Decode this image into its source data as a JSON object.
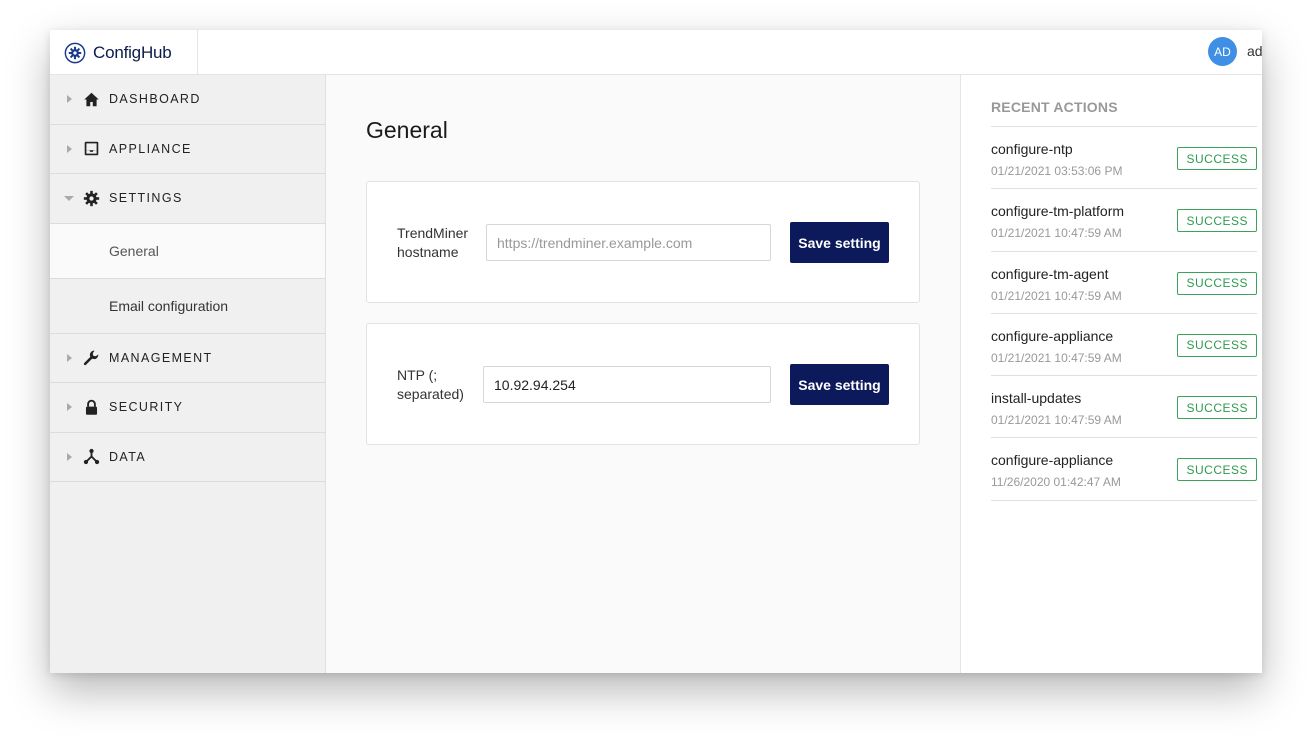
{
  "brand": {
    "name": "ConfigHub"
  },
  "user": {
    "initials": "AD",
    "name": "ad"
  },
  "sidebar": {
    "items": [
      {
        "label": "DASHBOARD",
        "icon": "home-icon"
      },
      {
        "label": "APPLIANCE",
        "icon": "inbox-icon"
      },
      {
        "label": "SETTINGS",
        "icon": "gear-icon",
        "expanded": true,
        "subitems": [
          {
            "label": "General",
            "active": true
          },
          {
            "label": "Email configuration",
            "active": false
          }
        ]
      },
      {
        "label": "MANAGEMENT",
        "icon": "wrench-icon"
      },
      {
        "label": "SECURITY",
        "icon": "lock-icon"
      },
      {
        "label": "DATA",
        "icon": "network-icon"
      }
    ]
  },
  "main": {
    "title": "General",
    "settings": [
      {
        "label_line1": "TrendMiner",
        "label_line2": "hostname",
        "value": "",
        "placeholder": "https://trendminer.example.com",
        "button": "Save setting"
      },
      {
        "label_line1": "NTP (;",
        "label_line2": "separated)",
        "value": "10.92.94.254",
        "placeholder": "",
        "button": "Save setting"
      }
    ]
  },
  "recent_actions": {
    "title": "RECENT ACTIONS",
    "items": [
      {
        "name": "configure-ntp",
        "time": "01/21/2021 03:53:06 PM",
        "status": "SUCCESS"
      },
      {
        "name": "configure-tm-platform",
        "time": "01/21/2021 10:47:59 AM",
        "status": "SUCCESS"
      },
      {
        "name": "configure-tm-agent",
        "time": "01/21/2021 10:47:59 AM",
        "status": "SUCCESS"
      },
      {
        "name": "configure-appliance",
        "time": "01/21/2021 10:47:59 AM",
        "status": "SUCCESS"
      },
      {
        "name": "install-updates",
        "time": "01/21/2021 10:47:59 AM",
        "status": "SUCCESS"
      },
      {
        "name": "configure-appliance",
        "time": "11/26/2020 01:42:47 AM",
        "status": "SUCCESS"
      }
    ]
  },
  "colors": {
    "brand": "#0b1b4d",
    "button": "#0c1a5b",
    "avatar": "#3f8fe4",
    "success": "#2e9a4f"
  }
}
